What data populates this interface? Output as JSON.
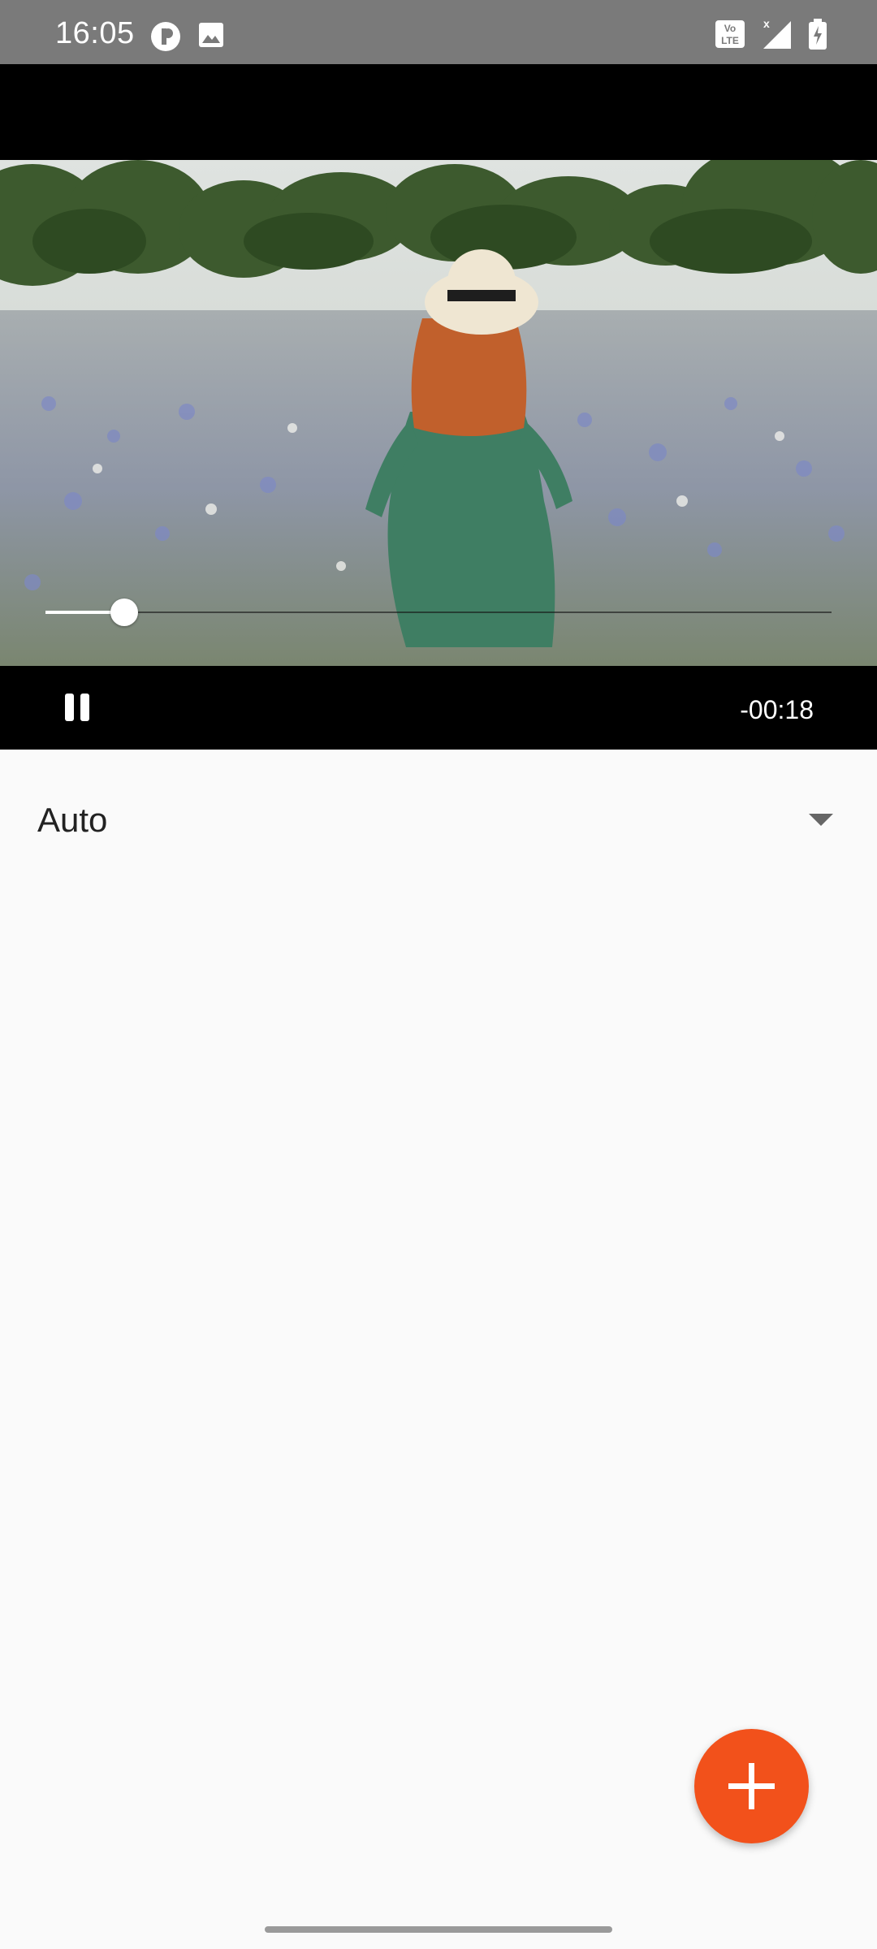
{
  "status_bar": {
    "time": "16:05",
    "left_icons": [
      "app-circle-icon",
      "image-icon"
    ],
    "right_icons": [
      "volte-icon",
      "signal-icon",
      "battery-charging-icon"
    ],
    "volte_text": "Vo LTE"
  },
  "player": {
    "state": "playing",
    "time_remaining": "-00:18",
    "progress_fraction": 0.1,
    "pause_label": "Pause"
  },
  "quality_dropdown": {
    "selected": "Auto"
  },
  "fab": {
    "icon": "plus-icon",
    "color": "#f2511b"
  },
  "colors": {
    "status_bar_bg": "#7a7a7a",
    "page_bg": "#fafafa",
    "fab": "#f2511b"
  }
}
